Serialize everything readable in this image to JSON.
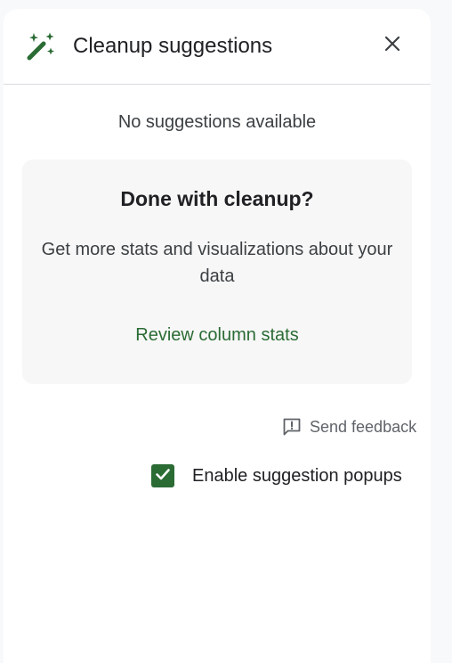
{
  "header": {
    "title": "Cleanup suggestions",
    "icon": "magic-wand-icon",
    "close_icon": "close-icon"
  },
  "status_text": "No suggestions available",
  "card": {
    "title": "Done with cleanup?",
    "description": "Get more stats and visualizations about your data",
    "link_label": "Review column stats"
  },
  "feedback": {
    "icon": "feedback-icon",
    "label": "Send feedback"
  },
  "popups_toggle": {
    "label": "Enable suggestion popups",
    "checked": true
  },
  "colors": {
    "accent": "#2b6b34",
    "text_primary": "#202124",
    "text_secondary": "#5f6368",
    "card_background": "#f7f7f7"
  }
}
